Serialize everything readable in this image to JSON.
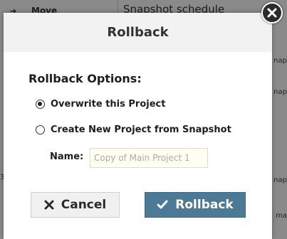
{
  "background": {
    "menu_item": {
      "icon": "arrow-right-icon",
      "label": "Move"
    },
    "panel_title": "Snapshot schedule",
    "snippets_right": [
      "nap",
      "nap",
      "nap",
      "ma"
    ],
    "snippet_left": "3"
  },
  "dialog": {
    "title": "Rollback",
    "close_icon": "close-icon",
    "options_heading": "Rollback Options:",
    "options": [
      {
        "label": "Overwrite this Project",
        "checked": true
      },
      {
        "label": "Create New Project from Snapshot",
        "checked": false
      }
    ],
    "name_label": "Name:",
    "name_value": "Copy of Main Project 1",
    "cancel_label": "Cancel",
    "cancel_icon": "x-icon",
    "rollback_label": "Rollback",
    "rollback_icon": "checkmark-icon"
  },
  "colors": {
    "overlay": "#8a8a8a",
    "header_bg": "#f2f2f2",
    "primary_button": "#4c7a96",
    "input_bg": "#fffff2"
  }
}
